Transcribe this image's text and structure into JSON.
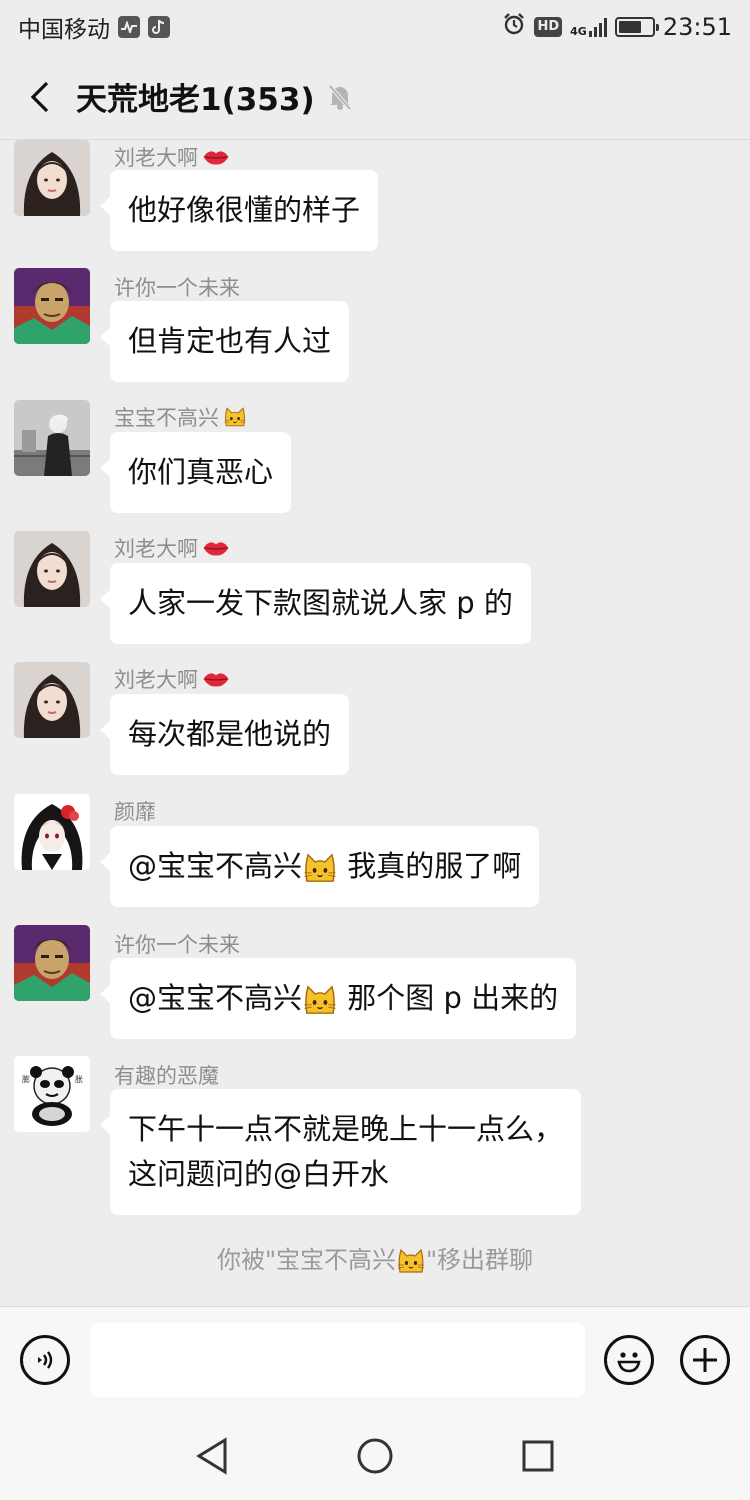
{
  "status_bar": {
    "carrier": "中国移动",
    "network": "4G",
    "hd": "HD",
    "time": "23:51",
    "battery_level": 0.7
  },
  "header": {
    "title": "天荒地老1(353)"
  },
  "messages": [
    {
      "sender": "刘老大啊",
      "sender_emoji": "lips-icon",
      "text": "他好像很懂的样子",
      "avatar": "woman-avatar"
    },
    {
      "sender": "许你一个未来",
      "text": "但肯定也有人过",
      "avatar": "man-colorful-avatar"
    },
    {
      "sender": "宝宝不高兴",
      "sender_emoji": "cat-icon",
      "text": "你们真恶心",
      "avatar": "man-bw-avatar"
    },
    {
      "sender": "刘老大啊",
      "sender_emoji": "lips-icon",
      "text": "人家一发下款图就说人家 p 的",
      "avatar": "woman-avatar"
    },
    {
      "sender": "刘老大啊",
      "sender_emoji": "lips-icon",
      "text": "每次都是他说的",
      "avatar": "woman-avatar"
    },
    {
      "sender": "颜靡",
      "text_a": "@宝宝不高兴",
      "text_b": " 我真的服了啊",
      "avatar": "anime-avatar"
    },
    {
      "sender": "许你一个未来",
      "text_a": "@宝宝不高兴",
      "text_b": " 那个图 p 出来的",
      "avatar": "man-colorful-avatar"
    },
    {
      "sender": "有趣的恶魔",
      "line1": "下午十一点不就是晚上十一点么，",
      "line2": "这问题问的@白开水",
      "avatar": "panda-meme-avatar"
    }
  ],
  "system_note": {
    "before": "你被\"宝宝不高兴",
    "after": "\"移出群聊"
  },
  "input": {
    "value": "",
    "placeholder": ""
  },
  "colors": {
    "background": "#ededed",
    "bubble": "#ffffff",
    "sender": "#8e8e8e"
  }
}
